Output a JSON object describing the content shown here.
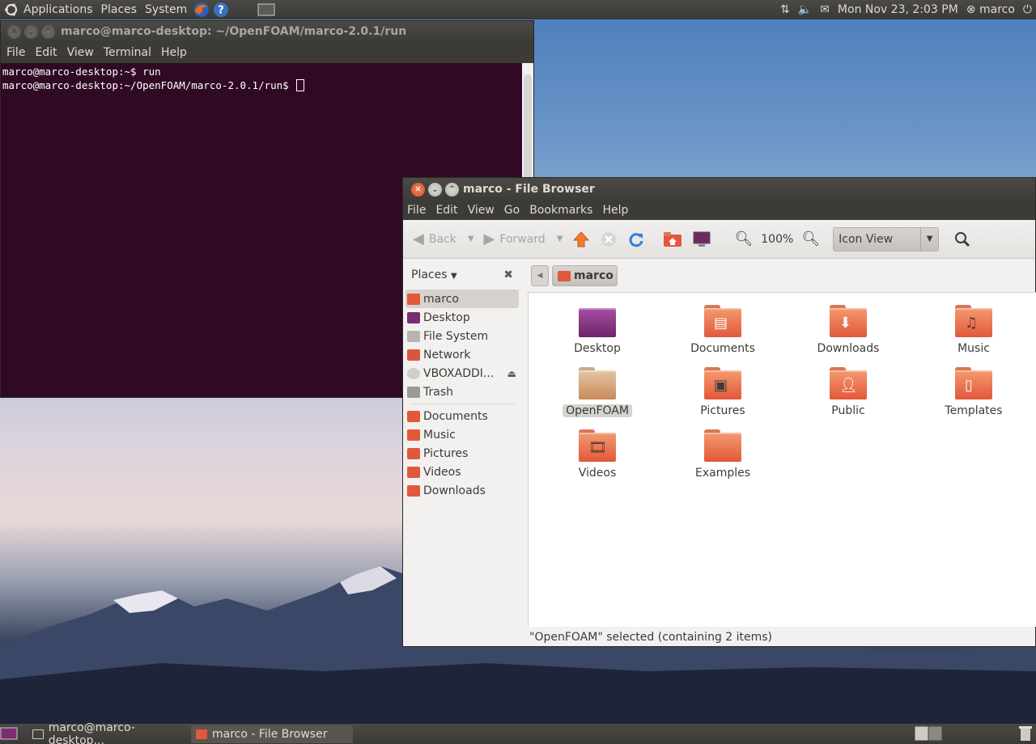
{
  "top_panel": {
    "menus": [
      "Applications",
      "Places",
      "System"
    ],
    "datetime": "Mon Nov 23,  2:03 PM",
    "user": "marco"
  },
  "terminal": {
    "title": "marco@marco-desktop: ~/OpenFOAM/marco-2.0.1/run",
    "menus": [
      "File",
      "Edit",
      "View",
      "Terminal",
      "Help"
    ],
    "lines": [
      "marco@marco-desktop:~$ run",
      "marco@marco-desktop:~/OpenFOAM/marco-2.0.1/run$ "
    ]
  },
  "filebrowser": {
    "title": "marco - File Browser",
    "menus": [
      "File",
      "Edit",
      "View",
      "Go",
      "Bookmarks",
      "Help"
    ],
    "toolbar": {
      "back": "Back",
      "forward": "Forward",
      "zoom": "100%",
      "view_mode": "Icon View"
    },
    "places_label": "Places",
    "sidebar": {
      "places": [
        "marco",
        "Desktop",
        "File System",
        "Network",
        "VBOXADDI...",
        "Trash"
      ],
      "bookmarks": [
        "Documents",
        "Music",
        "Pictures",
        "Videos",
        "Downloads"
      ]
    },
    "path_crumb": "marco",
    "items": [
      "Desktop",
      "Documents",
      "Downloads",
      "Music",
      "OpenFOAM",
      "Pictures",
      "Public",
      "Templates",
      "Videos",
      "Examples"
    ],
    "selected_item": "OpenFOAM",
    "status": "\"OpenFOAM\" selected (containing 2 items)"
  },
  "bottom_panel": {
    "tasks": [
      "marco@marco-desktop...",
      "marco - File Browser"
    ]
  },
  "colors": {
    "terminal_bg": "#300a24",
    "folder_orange": "#e2583b",
    "panel_bg": "#3c3b37"
  }
}
